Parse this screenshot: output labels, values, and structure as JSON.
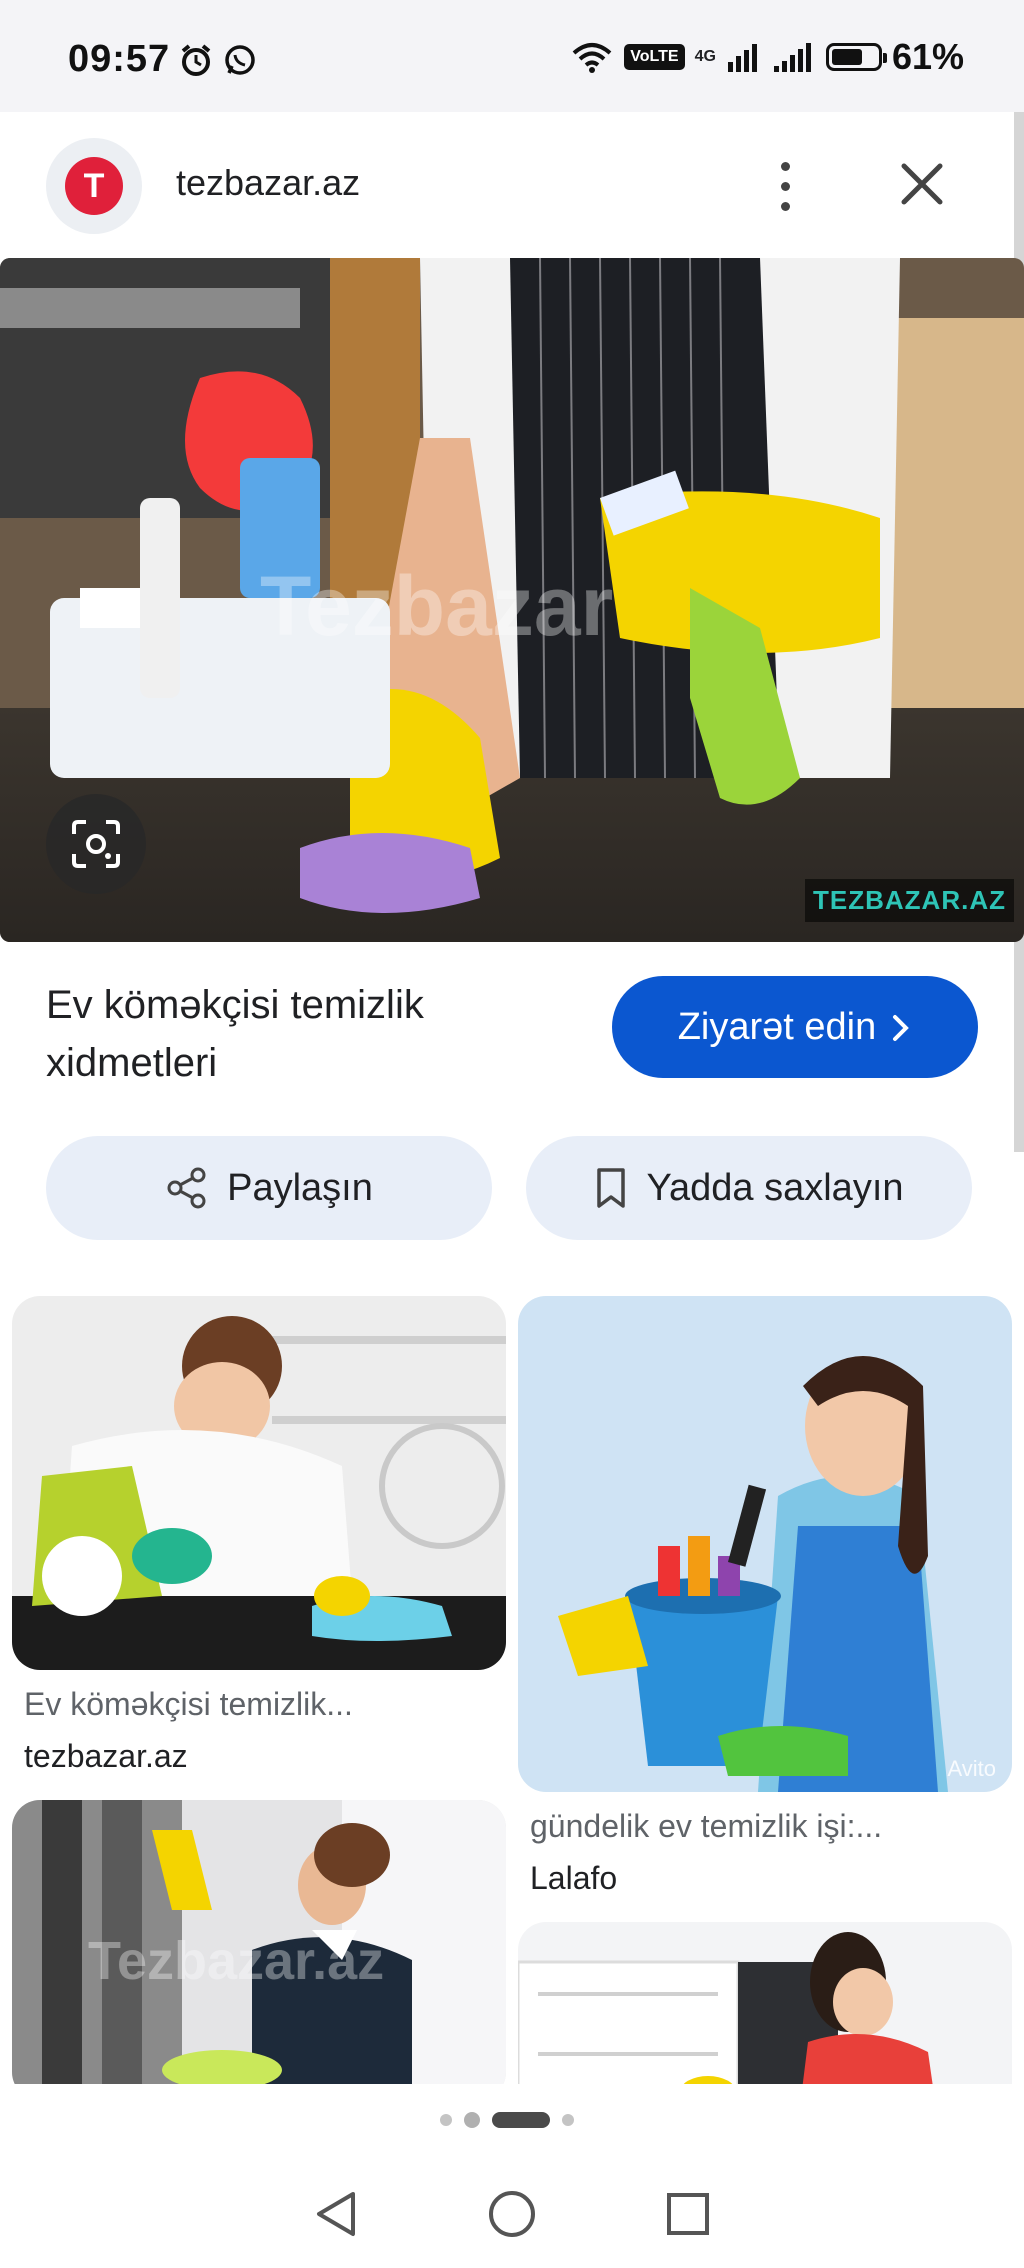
{
  "status_bar": {
    "time": "09:57",
    "volte": "VoLTE",
    "network": "4G",
    "battery_percent": "61%",
    "battery_level": 0.61
  },
  "header": {
    "favicon_letter": "T",
    "site": "tezbazar.az",
    "brand_color": "#e0203a"
  },
  "hero": {
    "watermark_center": "Tezbazar",
    "watermark_corner": "TEZBAZAR.AZ"
  },
  "result": {
    "title": "Ev köməkçisi temizlik xidmetleri",
    "visit_label": "Ziyarət edin",
    "accent": "#0b57d0"
  },
  "actions": {
    "share_label": "Paylaşın",
    "save_label": "Yadda saxlayın"
  },
  "related": [
    {
      "caption": "Ev köməkçisi temizlik...",
      "source": "tezbazar.az"
    },
    {
      "caption": "gündelik ev temizlik işi:...",
      "source": "Lalafo"
    }
  ],
  "related_watermarks": {
    "avito": "Avito",
    "tezbazar": "Tezbazar.az"
  }
}
